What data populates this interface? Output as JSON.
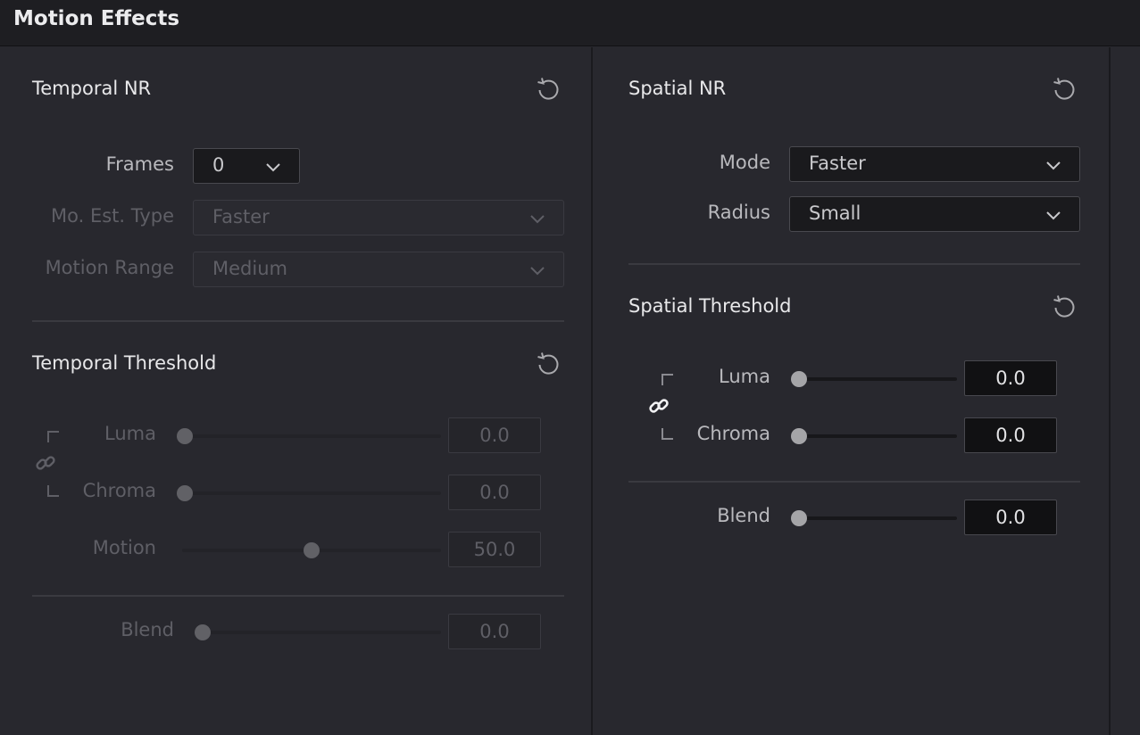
{
  "header": {
    "title": "Motion Effects"
  },
  "temporal_nr": {
    "title": "Temporal NR",
    "frames": {
      "label": "Frames",
      "value": "0"
    },
    "mo_est_type": {
      "label": "Mo. Est. Type",
      "value": "Faster"
    },
    "motion_range": {
      "label": "Motion Range",
      "value": "Medium"
    }
  },
  "temporal_threshold": {
    "title": "Temporal Threshold",
    "luma": {
      "label": "Luma",
      "value": "0.0",
      "fraction": 0.0
    },
    "chroma": {
      "label": "Chroma",
      "value": "0.0",
      "fraction": 0.0
    },
    "motion": {
      "label": "Motion",
      "value": "50.0",
      "fraction": 0.5
    },
    "blend": {
      "label": "Blend",
      "value": "0.0",
      "fraction": 0.0
    }
  },
  "spatial_nr": {
    "title": "Spatial NR",
    "mode": {
      "label": "Mode",
      "value": "Faster"
    },
    "radius": {
      "label": "Radius",
      "value": "Small"
    }
  },
  "spatial_threshold": {
    "title": "Spatial Threshold",
    "luma": {
      "label": "Luma",
      "value": "0.0",
      "fraction": 0.0
    },
    "chroma": {
      "label": "Chroma",
      "value": "0.0",
      "fraction": 0.0
    },
    "blend": {
      "label": "Blend",
      "value": "0.0",
      "fraction": 0.0
    }
  },
  "icons": {
    "reset": "reset-icon",
    "chevron": "chevron-down-icon",
    "link": "link-icon"
  }
}
